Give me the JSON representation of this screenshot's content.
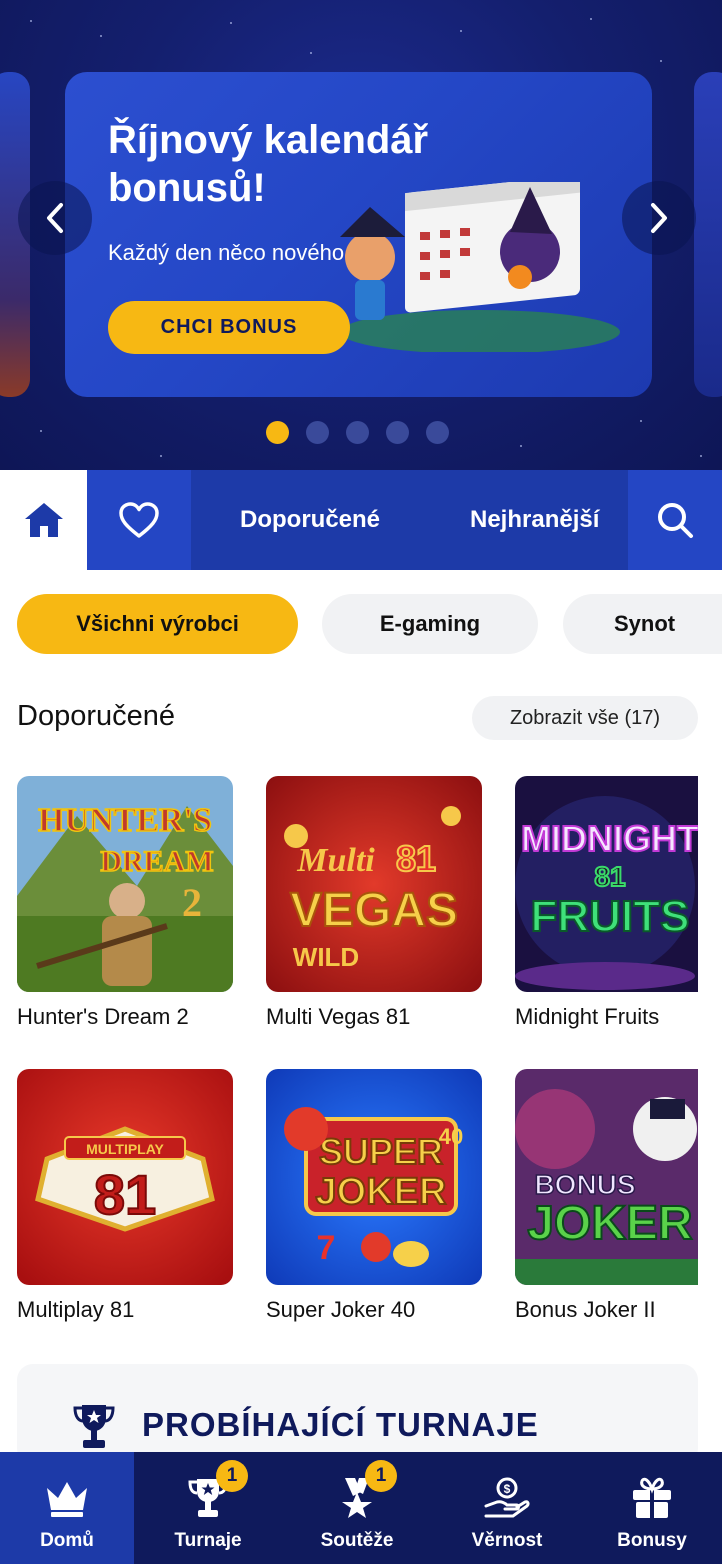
{
  "banner": {
    "title": "Říjnový kalendář bonusů!",
    "subtitle": "Každý den něco nového",
    "cta": "CHCI BONUS",
    "slides_total": 5,
    "active_slide": 1
  },
  "categories": {
    "tabs": [
      "Doporučené",
      "Nejhranější"
    ]
  },
  "filters": [
    "Všichni výrobci",
    "E-gaming",
    "Synot"
  ],
  "section": {
    "title": "Doporučené",
    "show_all": "Zobrazit vše (17)"
  },
  "games": [
    {
      "name": "Hunter's Dream 2"
    },
    {
      "name": "Multi Vegas 81"
    },
    {
      "name": "Midnight Fruits"
    },
    {
      "name": "Multiplay 81"
    },
    {
      "name": "Super Joker 40"
    },
    {
      "name": "Bonus Joker II"
    }
  ],
  "tournaments": {
    "title": "PROBÍHAJÍCÍ TURNAJE"
  },
  "nav": {
    "items": [
      {
        "label": "Domů",
        "icon": "crown-icon"
      },
      {
        "label": "Turnaje",
        "icon": "trophy-icon",
        "badge": "1"
      },
      {
        "label": "Soutěže",
        "icon": "medal-icon",
        "badge": "1"
      },
      {
        "label": "Věrnost",
        "icon": "loyalty-icon"
      },
      {
        "label": "Bonusy",
        "icon": "gift-icon"
      }
    ]
  },
  "colors": {
    "accent": "#f7b813",
    "primary": "#1d3aa8",
    "navy": "#0f1a5c"
  }
}
